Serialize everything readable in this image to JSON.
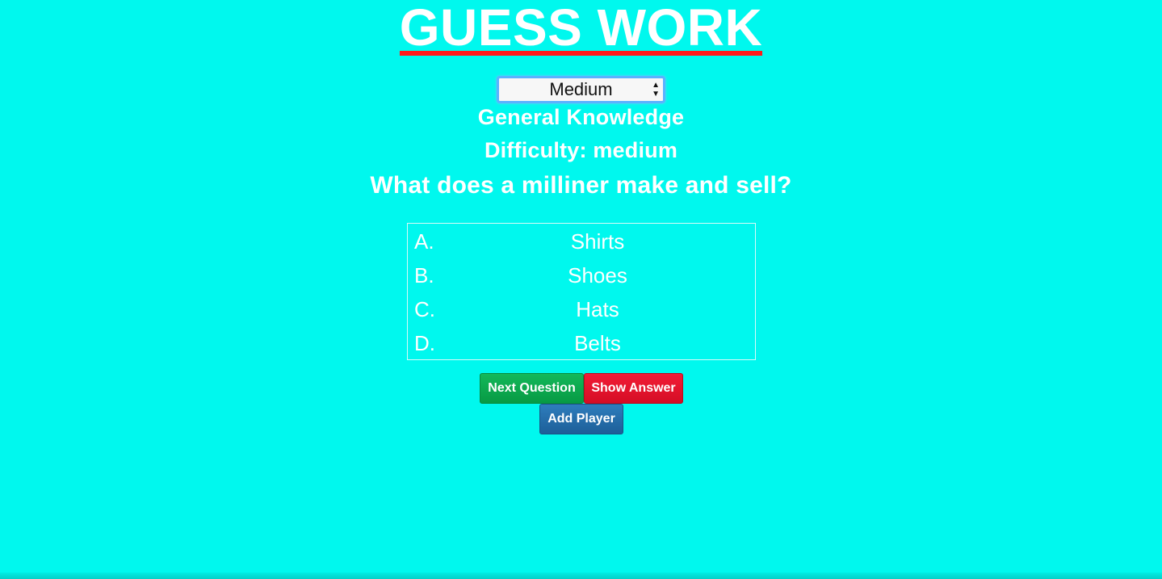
{
  "header": {
    "title": "GUESS WORK"
  },
  "controls": {
    "difficulty_selected": "Medium"
  },
  "quiz": {
    "category": "General Knowledge",
    "difficulty_text": "Difficulty: medium",
    "question": "What does a milliner make and sell?",
    "answers": [
      {
        "letter": "A.",
        "text": "Shirts"
      },
      {
        "letter": "B.",
        "text": "Shoes"
      },
      {
        "letter": "C.",
        "text": "Hats"
      },
      {
        "letter": "D.",
        "text": "Belts"
      }
    ]
  },
  "buttons": {
    "next_question": "Next Question",
    "show_answer": "Show Answer",
    "add_player": "Add Player"
  },
  "colors": {
    "background": "#00f8ee",
    "title_underline": "#ff1a1a",
    "next_button": "#079a44",
    "show_answer_button": "#d50d25",
    "add_player_button": "#1d5f99"
  },
  "icons": {
    "select_arrows": "up-down-arrows-icon"
  }
}
